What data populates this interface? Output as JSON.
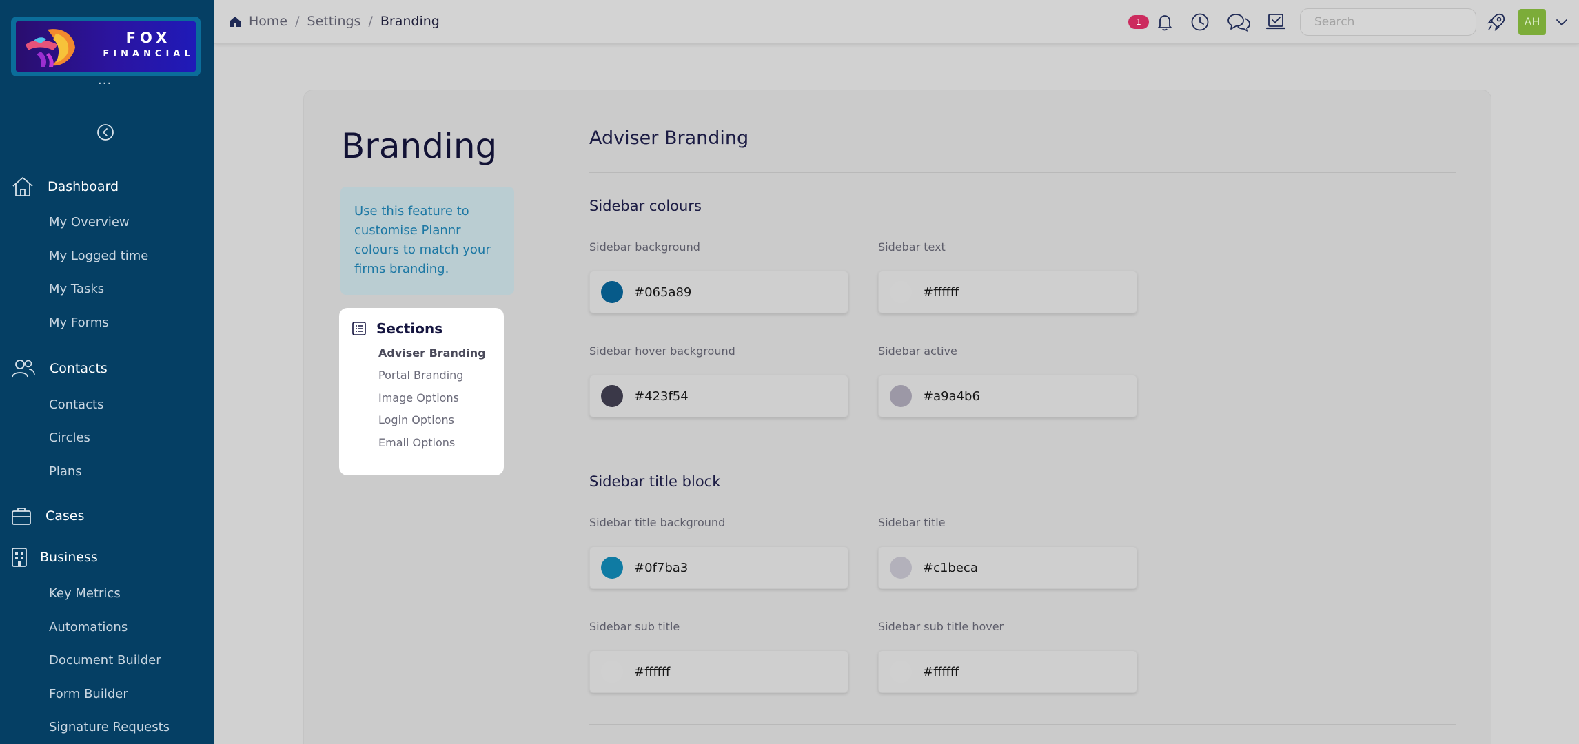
{
  "sidebar": {
    "logo": {
      "line1": "FOX",
      "line2": "FINANCIAL"
    },
    "more": "...",
    "sections": [
      {
        "label": "Dashboard",
        "items": [
          "My Overview",
          "My Logged time",
          "My Tasks",
          "My Forms"
        ]
      },
      {
        "label": "Contacts",
        "items": [
          "Contacts",
          "Circles",
          "Plans"
        ]
      },
      {
        "label": "Cases",
        "items": []
      },
      {
        "label": "Business",
        "items": [
          "Key Metrics",
          "Automations",
          "Document Builder",
          "Form Builder",
          "Signature Requests"
        ]
      }
    ]
  },
  "topbar": {
    "breadcrumb": [
      "Home",
      "Settings",
      "Branding"
    ],
    "notification_count": "1",
    "search_placeholder": "Search",
    "avatar_initials": "AH"
  },
  "page": {
    "title": "Branding",
    "info": "Use this feature to customise Plannr colours to match your firms branding.",
    "sections_title": "Sections",
    "sections": [
      "Adviser Branding",
      "Portal Branding",
      "Image Options",
      "Login Options",
      "Email Options"
    ],
    "active_section": "Adviser Branding"
  },
  "adviser_branding": {
    "title": "Adviser Branding",
    "groups": [
      {
        "title": "Sidebar colours",
        "fields": [
          {
            "label": "Sidebar background",
            "value": "#065a89",
            "swatch": "#065a89"
          },
          {
            "label": "Sidebar text",
            "value": "#ffffff",
            "swatch": "#d0d0d0"
          },
          {
            "label": "Sidebar hover background",
            "value": "#423f54",
            "swatch": "#3a3848"
          },
          {
            "label": "Sidebar active",
            "value": "#a9a4b6",
            "swatch": "#9c98a6"
          }
        ]
      },
      {
        "title": "Sidebar title block",
        "fields": [
          {
            "label": "Sidebar title background",
            "value": "#0f7ba3",
            "swatch": "#0f7ba3"
          },
          {
            "label": "Sidebar title",
            "value": "#c1beca",
            "swatch": "#b3b1bb"
          },
          {
            "label": "Sidebar sub title",
            "value": "#ffffff",
            "swatch": "#d0d0d0"
          },
          {
            "label": "Sidebar sub title hover",
            "value": "#ffffff",
            "swatch": "#d0d0d0"
          }
        ]
      }
    ]
  },
  "colors": {
    "sidebar_bg": "#053f64",
    "accent": "#1d78a4",
    "badge": "#cc2b5e",
    "avatar": "#7cac39"
  },
  "icons": [
    "home-icon",
    "contacts-icon",
    "cases-icon",
    "business-icon",
    "bell-icon",
    "clock-icon",
    "chat-icon",
    "tasks-icon",
    "rocket-icon",
    "chevron-down-icon",
    "collapse-icon",
    "list-icon"
  ]
}
